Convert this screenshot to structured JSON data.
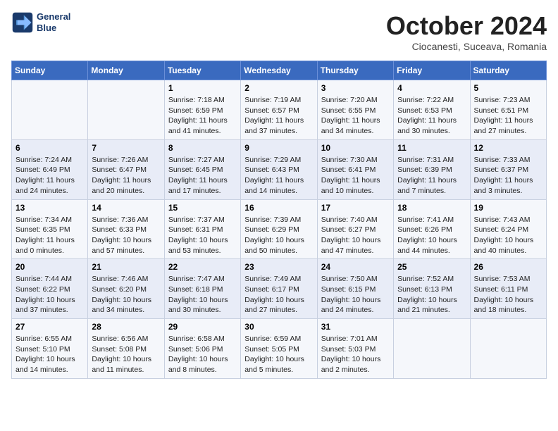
{
  "logo": {
    "line1": "General",
    "line2": "Blue"
  },
  "title": "October 2024",
  "location": "Ciocanesti, Suceava, Romania",
  "headers": [
    "Sunday",
    "Monday",
    "Tuesday",
    "Wednesday",
    "Thursday",
    "Friday",
    "Saturday"
  ],
  "weeks": [
    [
      {
        "day": "",
        "info": ""
      },
      {
        "day": "",
        "info": ""
      },
      {
        "day": "1",
        "info": "Sunrise: 7:18 AM\nSunset: 6:59 PM\nDaylight: 11 hours and 41 minutes."
      },
      {
        "day": "2",
        "info": "Sunrise: 7:19 AM\nSunset: 6:57 PM\nDaylight: 11 hours and 37 minutes."
      },
      {
        "day": "3",
        "info": "Sunrise: 7:20 AM\nSunset: 6:55 PM\nDaylight: 11 hours and 34 minutes."
      },
      {
        "day": "4",
        "info": "Sunrise: 7:22 AM\nSunset: 6:53 PM\nDaylight: 11 hours and 30 minutes."
      },
      {
        "day": "5",
        "info": "Sunrise: 7:23 AM\nSunset: 6:51 PM\nDaylight: 11 hours and 27 minutes."
      }
    ],
    [
      {
        "day": "6",
        "info": "Sunrise: 7:24 AM\nSunset: 6:49 PM\nDaylight: 11 hours and 24 minutes."
      },
      {
        "day": "7",
        "info": "Sunrise: 7:26 AM\nSunset: 6:47 PM\nDaylight: 11 hours and 20 minutes."
      },
      {
        "day": "8",
        "info": "Sunrise: 7:27 AM\nSunset: 6:45 PM\nDaylight: 11 hours and 17 minutes."
      },
      {
        "day": "9",
        "info": "Sunrise: 7:29 AM\nSunset: 6:43 PM\nDaylight: 11 hours and 14 minutes."
      },
      {
        "day": "10",
        "info": "Sunrise: 7:30 AM\nSunset: 6:41 PM\nDaylight: 11 hours and 10 minutes."
      },
      {
        "day": "11",
        "info": "Sunrise: 7:31 AM\nSunset: 6:39 PM\nDaylight: 11 hours and 7 minutes."
      },
      {
        "day": "12",
        "info": "Sunrise: 7:33 AM\nSunset: 6:37 PM\nDaylight: 11 hours and 3 minutes."
      }
    ],
    [
      {
        "day": "13",
        "info": "Sunrise: 7:34 AM\nSunset: 6:35 PM\nDaylight: 11 hours and 0 minutes."
      },
      {
        "day": "14",
        "info": "Sunrise: 7:36 AM\nSunset: 6:33 PM\nDaylight: 10 hours and 57 minutes."
      },
      {
        "day": "15",
        "info": "Sunrise: 7:37 AM\nSunset: 6:31 PM\nDaylight: 10 hours and 53 minutes."
      },
      {
        "day": "16",
        "info": "Sunrise: 7:39 AM\nSunset: 6:29 PM\nDaylight: 10 hours and 50 minutes."
      },
      {
        "day": "17",
        "info": "Sunrise: 7:40 AM\nSunset: 6:27 PM\nDaylight: 10 hours and 47 minutes."
      },
      {
        "day": "18",
        "info": "Sunrise: 7:41 AM\nSunset: 6:26 PM\nDaylight: 10 hours and 44 minutes."
      },
      {
        "day": "19",
        "info": "Sunrise: 7:43 AM\nSunset: 6:24 PM\nDaylight: 10 hours and 40 minutes."
      }
    ],
    [
      {
        "day": "20",
        "info": "Sunrise: 7:44 AM\nSunset: 6:22 PM\nDaylight: 10 hours and 37 minutes."
      },
      {
        "day": "21",
        "info": "Sunrise: 7:46 AM\nSunset: 6:20 PM\nDaylight: 10 hours and 34 minutes."
      },
      {
        "day": "22",
        "info": "Sunrise: 7:47 AM\nSunset: 6:18 PM\nDaylight: 10 hours and 30 minutes."
      },
      {
        "day": "23",
        "info": "Sunrise: 7:49 AM\nSunset: 6:17 PM\nDaylight: 10 hours and 27 minutes."
      },
      {
        "day": "24",
        "info": "Sunrise: 7:50 AM\nSunset: 6:15 PM\nDaylight: 10 hours and 24 minutes."
      },
      {
        "day": "25",
        "info": "Sunrise: 7:52 AM\nSunset: 6:13 PM\nDaylight: 10 hours and 21 minutes."
      },
      {
        "day": "26",
        "info": "Sunrise: 7:53 AM\nSunset: 6:11 PM\nDaylight: 10 hours and 18 minutes."
      }
    ],
    [
      {
        "day": "27",
        "info": "Sunrise: 6:55 AM\nSunset: 5:10 PM\nDaylight: 10 hours and 14 minutes."
      },
      {
        "day": "28",
        "info": "Sunrise: 6:56 AM\nSunset: 5:08 PM\nDaylight: 10 hours and 11 minutes."
      },
      {
        "day": "29",
        "info": "Sunrise: 6:58 AM\nSunset: 5:06 PM\nDaylight: 10 hours and 8 minutes."
      },
      {
        "day": "30",
        "info": "Sunrise: 6:59 AM\nSunset: 5:05 PM\nDaylight: 10 hours and 5 minutes."
      },
      {
        "day": "31",
        "info": "Sunrise: 7:01 AM\nSunset: 5:03 PM\nDaylight: 10 hours and 2 minutes."
      },
      {
        "day": "",
        "info": ""
      },
      {
        "day": "",
        "info": ""
      }
    ]
  ]
}
